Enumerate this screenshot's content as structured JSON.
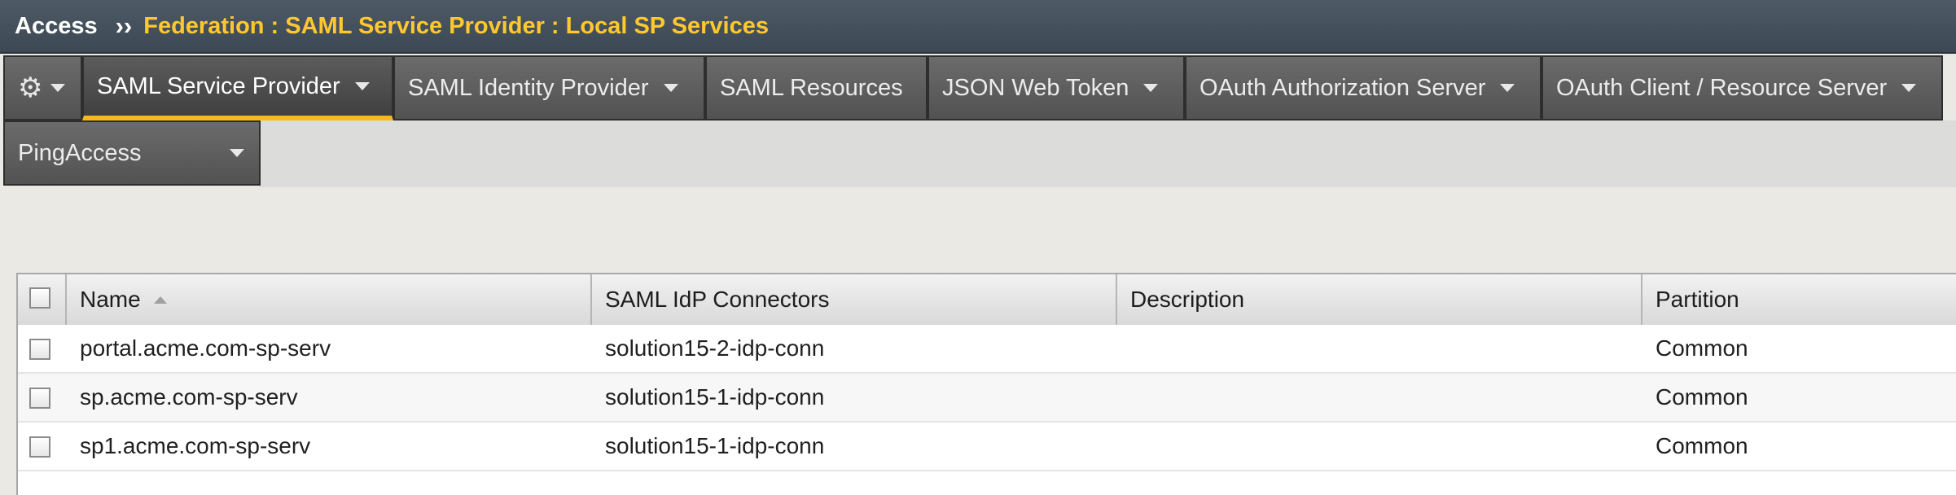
{
  "breadcrumb": {
    "root": "Access",
    "separator": "››",
    "path": "Federation : SAML Service Provider : Local SP Services"
  },
  "tabs": {
    "settings_icon": "gear-icon",
    "items": [
      {
        "label": "SAML Service Provider",
        "active": true,
        "has_dropdown": true
      },
      {
        "label": "SAML Identity Provider",
        "active": false,
        "has_dropdown": true
      },
      {
        "label": "SAML Resources",
        "active": false,
        "has_dropdown": false
      },
      {
        "label": "JSON Web Token",
        "active": false,
        "has_dropdown": true
      },
      {
        "label": "OAuth Authorization Server",
        "active": false,
        "has_dropdown": true
      },
      {
        "label": "OAuth Client / Resource Server",
        "active": false,
        "has_dropdown": true
      },
      {
        "label": "PingAccess",
        "active": false,
        "has_dropdown": true
      }
    ]
  },
  "table": {
    "columns": [
      "Name",
      "SAML IdP Connectors",
      "Description",
      "Partition"
    ],
    "sorted_column": "Name",
    "sort_direction": "ascending",
    "rows": [
      {
        "name": "portal.acme.com-sp-serv",
        "connectors": "solution15-2-idp-conn",
        "description": "",
        "partition": "Common"
      },
      {
        "name": "sp.acme.com-sp-serv",
        "connectors": "solution15-1-idp-conn",
        "description": "",
        "partition": "Common"
      },
      {
        "name": "sp1.acme.com-sp-serv",
        "connectors": "solution15-1-idp-conn",
        "description": "",
        "partition": "Common"
      }
    ]
  },
  "colors": {
    "breadcrumb_path": "#ffc82e",
    "active_tab_underline": "#f5b91a",
    "tab_background": "#5e5e5e"
  }
}
